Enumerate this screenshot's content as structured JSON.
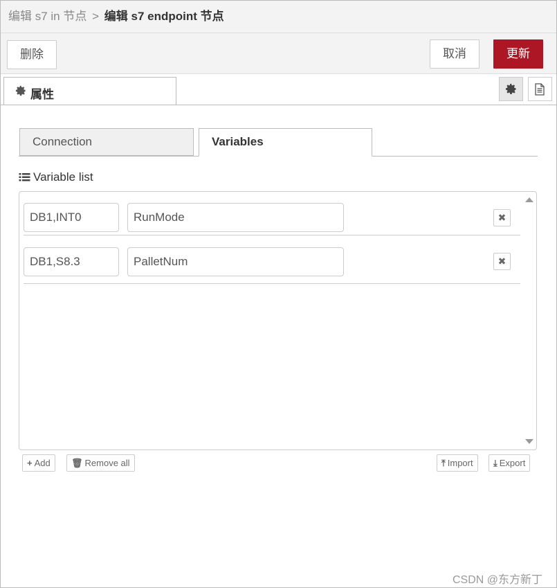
{
  "breadcrumb": {
    "parent": "编辑 s7 in 节点",
    "separator": ">",
    "current": "编辑 s7 endpoint 节点"
  },
  "toolbar": {
    "delete_label": "删除",
    "cancel_label": "取消",
    "update_label": "更新",
    "accent_color": "#ad1625"
  },
  "tabs": {
    "properties_label": "属性",
    "settings_icon": "gear-icon",
    "info_icon": "document-icon"
  },
  "subtabs": [
    {
      "label": "Connection",
      "active": false
    },
    {
      "label": "Variables",
      "active": true
    }
  ],
  "variable_list": {
    "title": "Variable list",
    "rows": [
      {
        "address": "DB1,INT0",
        "name": "RunMode"
      },
      {
        "address": "DB1,S8.3",
        "name": "PalletNum"
      }
    ]
  },
  "footer": {
    "add_label": "Add",
    "remove_all_label": "Remove all",
    "import_label": "Import",
    "export_label": "Export"
  },
  "watermark": "CSDN @东方新丁"
}
